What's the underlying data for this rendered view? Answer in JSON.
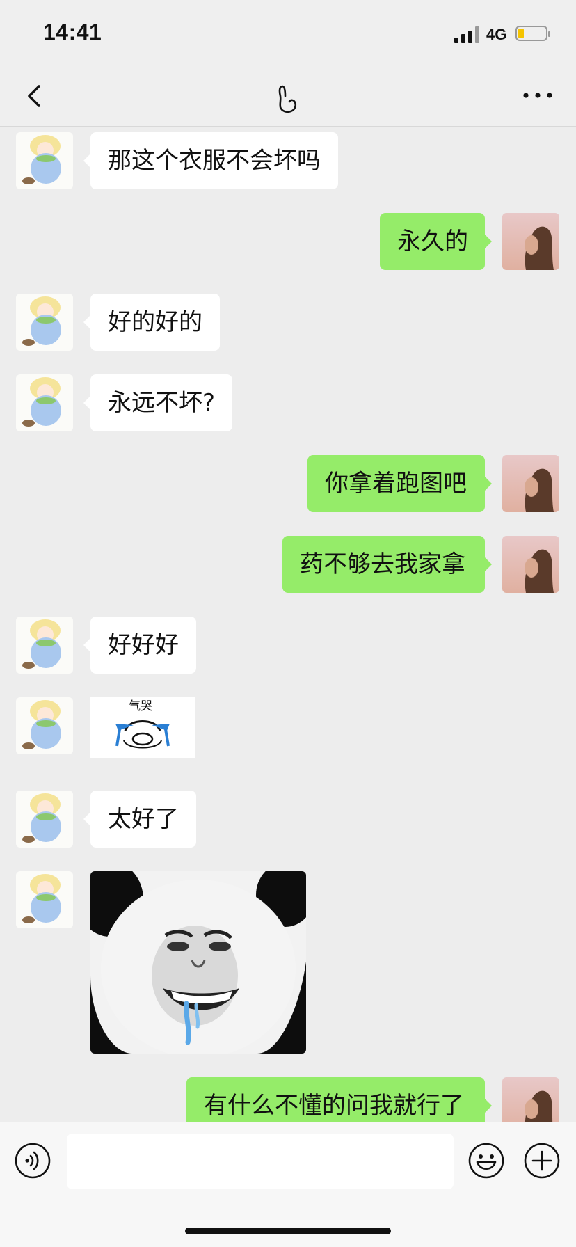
{
  "status_bar": {
    "time": "14:41",
    "network": "4G",
    "battery_level": 0.2
  },
  "nav": {
    "back_icon": "chevron-left-icon",
    "title_icon": "hand-gesture-icon",
    "more_icon": "more-dots-icon"
  },
  "messages": [
    {
      "side": "left",
      "type": "text",
      "text": "那这个衣服不会坏吗"
    },
    {
      "side": "right",
      "type": "text",
      "text": "永久的"
    },
    {
      "side": "left",
      "type": "text",
      "text": "好的好的"
    },
    {
      "side": "left",
      "type": "text",
      "text": "永远不坏?"
    },
    {
      "side": "right",
      "type": "text",
      "text": "你拿着跑图吧"
    },
    {
      "side": "right",
      "type": "text",
      "text": "药不够去我家拿"
    },
    {
      "side": "left",
      "type": "text",
      "text": "好好好"
    },
    {
      "side": "left",
      "type": "sticker",
      "caption": "气哭",
      "sticker": "crying-face-sticker"
    },
    {
      "side": "left",
      "type": "text",
      "text": "太好了"
    },
    {
      "side": "left",
      "type": "sticker",
      "sticker": "panda-drooling-sticker"
    },
    {
      "side": "right",
      "type": "text",
      "text": "有什么不懂的问我就行了"
    }
  ],
  "input_bar": {
    "placeholder": "",
    "voice_icon": "voice-icon",
    "emoji_icon": "emoji-icon",
    "plus_icon": "plus-icon"
  },
  "colors": {
    "background": "#ededed",
    "outgoing_bubble": "#95ec69",
    "incoming_bubble": "#ffffff"
  }
}
